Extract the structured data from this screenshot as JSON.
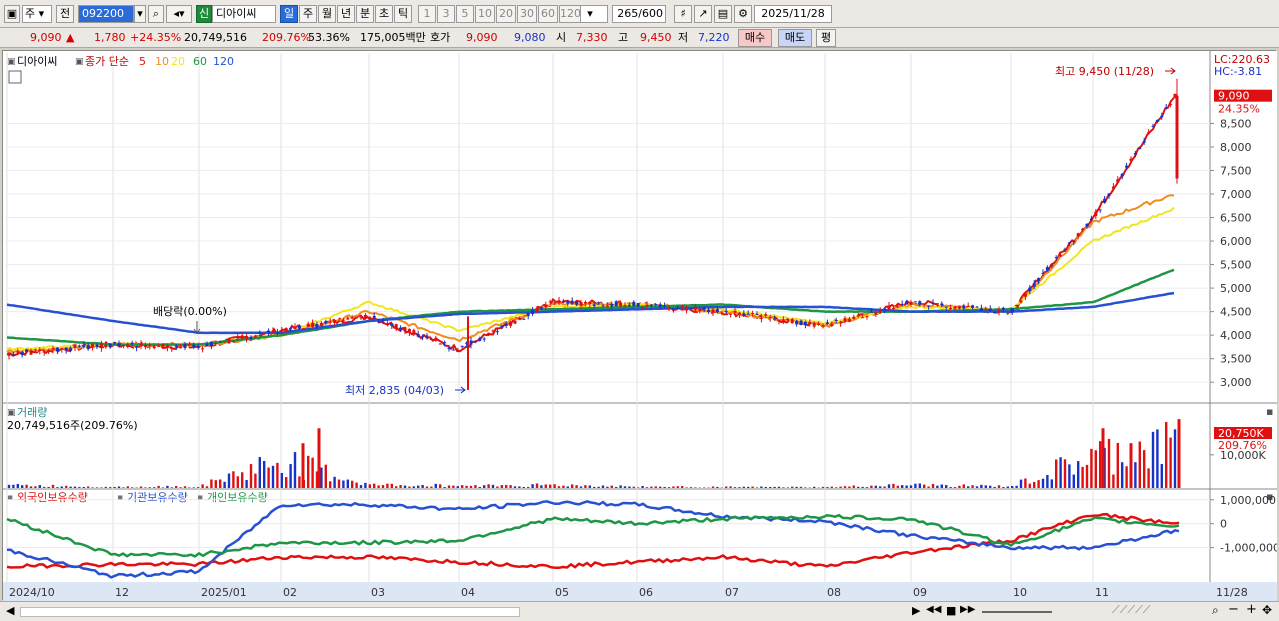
{
  "toolbar": {
    "period_select": "주",
    "prev_label": "전",
    "stock_code": "092200",
    "new_badge": "신",
    "stock_name": "디아이씨",
    "periods": [
      "일",
      "주",
      "월",
      "년",
      "분",
      "초",
      "틱"
    ],
    "intervals": [
      "1",
      "3",
      "5",
      "10",
      "20",
      "30",
      "60",
      "120"
    ],
    "count": "265",
    "count_total": "/600",
    "date": "2025/11/28"
  },
  "quote": {
    "price": "9,090",
    "arrow": "▲",
    "change": "1,780",
    "change_pct": "+24.35%",
    "volume": "20,749,516",
    "volume_ratio": "209.76%",
    "turnover": "53.36%",
    "amount": "175,005백만",
    "hoga_label": "호가",
    "ask": "9,090",
    "bid": "9,080",
    "open_label": "시",
    "open": "7,330",
    "high_label": "고",
    "high": "9,450",
    "low_label": "저",
    "low": "7,220",
    "buy_label": "매수",
    "sell_label": "매도",
    "eval_label": "평"
  },
  "price_panel": {
    "title": "디아이씨",
    "ma_label": "종가 단순",
    "ma_periods": [
      "5",
      "10",
      "20",
      "60",
      "120"
    ],
    "ma_colors": [
      "#e01010",
      "#f08c1e",
      "#f0e61e",
      "#1e9646",
      "#2850d2"
    ],
    "lc": "LC:220.63",
    "hc": "HC:-3.81",
    "price_tag": "9,090",
    "pct_tag": "24.35%",
    "high_annotation": "최고 9,450 (11/28)",
    "low_annotation": "최저 2,835 (04/03)",
    "dividend_annotation": "배당락(0.00%)",
    "y_ticks": [
      "8,500",
      "8,000",
      "7,500",
      "7,000",
      "6,500",
      "6,000",
      "5,500",
      "5,000",
      "4,500",
      "4,000",
      "3,500",
      "3,000"
    ]
  },
  "volume_panel": {
    "title": "거래량",
    "value": "20,749,516주(209.76%)",
    "tag_value": "20,750K",
    "tag_pct": "209.76%",
    "y_tick": "10,000K"
  },
  "holdings_panel": {
    "series_labels": [
      "외국인보유수량",
      "기관보유수량",
      "개인보유수량"
    ],
    "series_colors": [
      "#e01010",
      "#2850d2",
      "#1e9646"
    ],
    "y_ticks": [
      "1,000,000",
      "0",
      "-1,000,000"
    ]
  },
  "x_axis": {
    "labels": [
      "2024/10",
      "12",
      "2025/01",
      "02",
      "03",
      "04",
      "05",
      "06",
      "07",
      "08",
      "09",
      "10",
      "11"
    ],
    "last_label": "11/28"
  },
  "chart_data": [
    {
      "type": "line",
      "title": "디아이씨",
      "x": [
        "2024/10",
        "12",
        "2025/01",
        "02",
        "03",
        "04",
        "05",
        "06",
        "07",
        "08",
        "09",
        "10",
        "11",
        "11/28"
      ],
      "series": [
        {
          "name": "5",
          "values": [
            3600,
            3800,
            3750,
            4100,
            4400,
            3700,
            4700,
            4650,
            4500,
            4200,
            4700,
            4500,
            6500,
            9090
          ]
        },
        {
          "name": "10",
          "values": [
            3650,
            3800,
            3800,
            4000,
            4500,
            3900,
            4650,
            4650,
            4500,
            4200,
            4650,
            4500,
            6400,
            7000
          ]
        },
        {
          "name": "20",
          "values": [
            3700,
            3800,
            3800,
            4000,
            4700,
            4100,
            4600,
            4650,
            4550,
            4250,
            4600,
            4550,
            6000,
            6700
          ]
        },
        {
          "name": "60",
          "values": [
            3950,
            3800,
            3800,
            4000,
            4300,
            4500,
            4550,
            4600,
            4650,
            4500,
            4500,
            4550,
            4700,
            5400
          ]
        },
        {
          "name": "120",
          "values": [
            4650,
            4300,
            4050,
            4050,
            4300,
            4450,
            4500,
            4550,
            4600,
            4600,
            4500,
            4500,
            4600,
            4900
          ]
        }
      ],
      "ylim": [
        2600,
        9700
      ],
      "high": 9450,
      "low": 2835
    },
    {
      "type": "bar",
      "title": "거래량",
      "categories": [
        "2024/10",
        "12",
        "2025/01",
        "02",
        "03",
        "04",
        "05",
        "06",
        "07",
        "08",
        "09",
        "10",
        "11",
        "11/28"
      ],
      "values": [
        1300,
        600,
        700,
        13500,
        1500,
        1200,
        1500,
        700,
        500,
        400,
        1500,
        800,
        15000,
        20750
      ],
      "ylim": [
        0,
        22000
      ]
    },
    {
      "type": "line",
      "title": "보유수량",
      "x": [
        "2024/10",
        "12",
        "2025/01",
        "02",
        "03",
        "04",
        "05",
        "06",
        "07",
        "08",
        "09",
        "10",
        "11",
        "11/28"
      ],
      "series": [
        {
          "name": "외국인보유수량",
          "values": [
            -1800000,
            -1700000,
            -1700000,
            -1400000,
            -1400000,
            -1600000,
            -1800000,
            -1600000,
            -1400000,
            -1800000,
            -1200000,
            -700000,
            400000,
            0
          ]
        },
        {
          "name": "기관보유수량",
          "values": [
            -1100000,
            -2200000,
            -2000000,
            800000,
            800000,
            600000,
            900000,
            800000,
            300000,
            100000,
            -500000,
            -1000000,
            -1000000,
            -300000
          ]
        },
        {
          "name": "개인보유수량",
          "values": [
            200000,
            -1300000,
            -1300000,
            -800000,
            -800000,
            -700000,
            200000,
            0,
            200000,
            300000,
            200000,
            -900000,
            200000,
            -100000
          ]
        }
      ],
      "ylim": [
        -2400000,
        1200000
      ]
    }
  ],
  "statusbar": {
    "nav": [
      "▶",
      "◀◀",
      "■",
      "▶▶"
    ],
    "zoom": [
      "−",
      "+"
    ]
  }
}
